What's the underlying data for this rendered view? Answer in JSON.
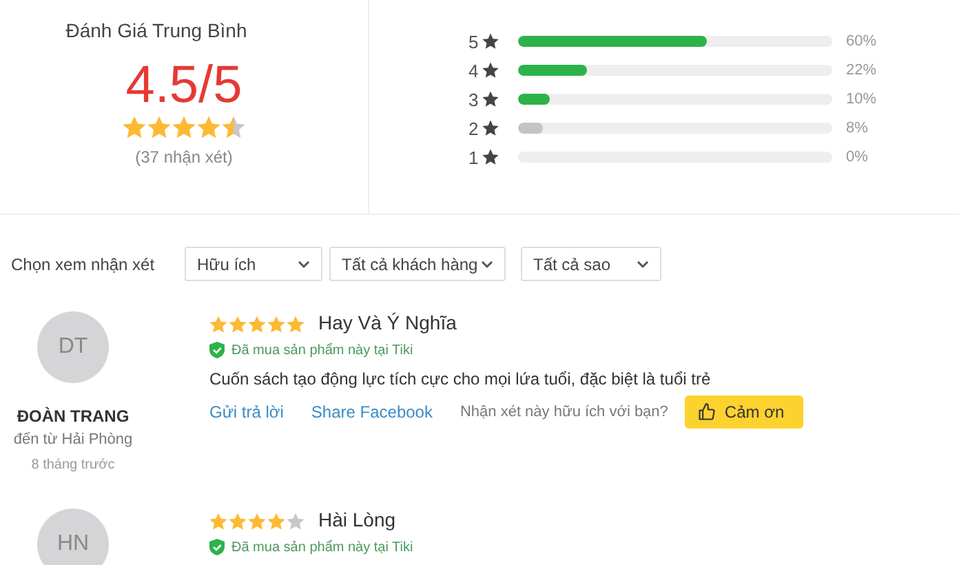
{
  "summary": {
    "title": "Đánh Giá Trung Bình",
    "score": "4.5/5",
    "stars": 4.5,
    "count": "(37 nhận xét)"
  },
  "breakdown": [
    {
      "label": "5",
      "level": 0.6,
      "percent": "60%",
      "color": "#2db24a"
    },
    {
      "label": "4",
      "level": 0.22,
      "percent": "22%",
      "color": "#2db24a"
    },
    {
      "label": "3",
      "level": 0.1,
      "percent": "10%",
      "color": "#2db24a"
    },
    {
      "label": "2",
      "level": 0.08,
      "percent": "8%",
      "color": "#c4c4c4"
    },
    {
      "label": "1",
      "percent": "0%"
    }
  ],
  "filters": {
    "label": "Chọn xem nhận xét",
    "dropdowns": [
      "Hữu ích",
      "Tất cả khách hàng",
      "Tất cả sao"
    ]
  },
  "reviews": [
    {
      "initials": "DT",
      "name": "ĐOÀN TRANG",
      "location_prefix": "đến từ",
      "location": "Hải Phòng",
      "time": "8 tháng trước",
      "stars": 5,
      "title": "Hay Và Ý Nghĩa",
      "verified": "Đã mua sản phẩm này tại Tiki",
      "text": "Cuốn sách tạo động lực tích cực cho mọi lứa tuổi, đặc biệt là tuổi trẻ",
      "reply": "Gửi trả lời",
      "share": "Share Facebook",
      "helpful_question": "Nhận xét này hữu ích với bạn?",
      "thanks": "Cảm ơn"
    },
    {
      "initials": "HN",
      "stars": 4,
      "title": "Hài Lòng",
      "verified": "Đã mua sản phẩm này tại Tiki"
    }
  ]
}
